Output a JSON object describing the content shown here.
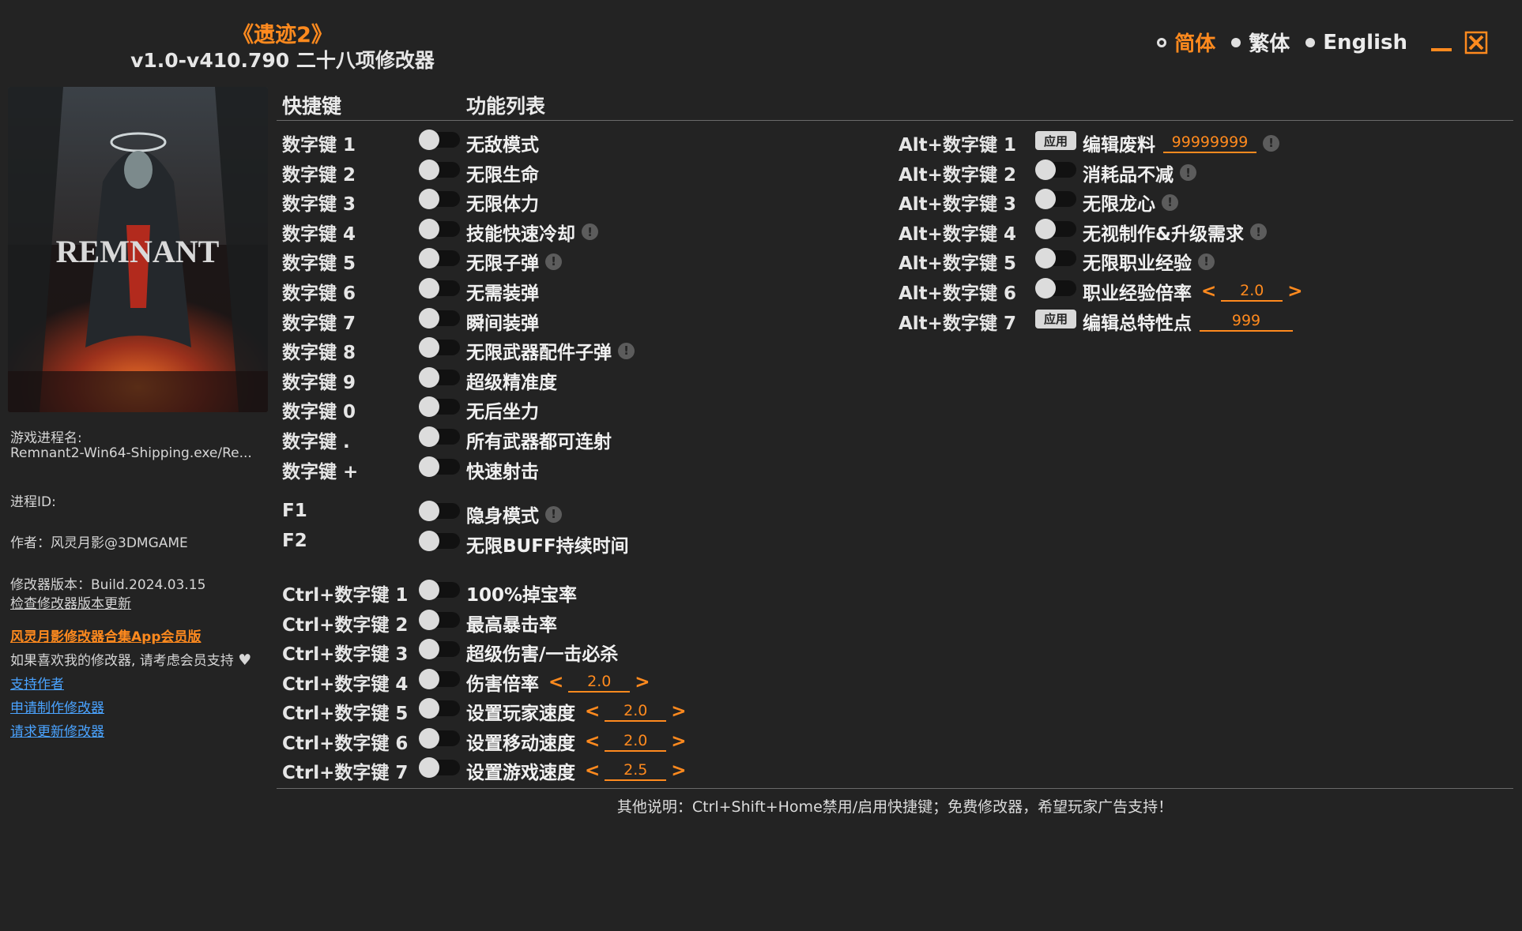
{
  "header": {
    "game_title": "《遗迹2》",
    "trainer_title": "v1.0-v410.790 二十八项修改器"
  },
  "language": {
    "options": [
      {
        "label": "简体",
        "active": true
      },
      {
        "label": "繁体",
        "active": false
      },
      {
        "label": "English",
        "active": false
      }
    ]
  },
  "window": {
    "minimize_icon": "minimize-icon",
    "close_icon": "close-icon",
    "accent": "#ff8a1e"
  },
  "cover": {
    "text": "REMNANT"
  },
  "sidebar": {
    "process_name_label": "游戏进程名:",
    "process_name_value": "Remnant2-Win64-Shipping.exe/Re...",
    "process_id_label": "进程ID:",
    "author": "作者：风灵月影@3DMGAME",
    "version": "修改器版本：Build.2024.03.15",
    "check_update": "检查修改器版本更新",
    "vip_link": "风灵月影修改器合集App会员版",
    "support_text": "如果喜欢我的修改器, 请考虑会员支持",
    "links": [
      "支持作者",
      "申请制作修改器",
      "请求更新修改器"
    ]
  },
  "columns": {
    "hotkey_header": "快捷键",
    "function_header": "功能列表"
  },
  "left_group_1": [
    {
      "key": "数字键 1",
      "label": "无敌模式",
      "info": false
    },
    {
      "key": "数字键 2",
      "label": "无限生命",
      "info": false
    },
    {
      "key": "数字键 3",
      "label": "无限体力",
      "info": false
    },
    {
      "key": "数字键 4",
      "label": "技能快速冷却",
      "info": true
    },
    {
      "key": "数字键 5",
      "label": "无限子弹",
      "info": true
    },
    {
      "key": "数字键 6",
      "label": "无需装弹",
      "info": false
    },
    {
      "key": "数字键 7",
      "label": "瞬间装弹",
      "info": false
    },
    {
      "key": "数字键 8",
      "label": "无限武器配件子弹",
      "info": true
    },
    {
      "key": "数字键 9",
      "label": "超级精准度",
      "info": false
    },
    {
      "key": "数字键 0",
      "label": "无后坐力",
      "info": false
    },
    {
      "key": "数字键 .",
      "label": "所有武器都可连射",
      "info": false
    },
    {
      "key": "数字键 +",
      "label": "快速射击",
      "info": false
    }
  ],
  "left_group_2": [
    {
      "key": "F1",
      "label": "隐身模式",
      "info": true
    },
    {
      "key": "F2",
      "label": "无限BUFF持续时间",
      "info": false
    }
  ],
  "left_group_3": [
    {
      "key": "Ctrl+数字键 1",
      "label": "100%掉宝率",
      "info": false
    },
    {
      "key": "Ctrl+数字键 2",
      "label": "最高暴击率",
      "info": false
    },
    {
      "key": "Ctrl+数字键 3",
      "label": "超级伤害/一击必杀",
      "info": false
    },
    {
      "key": "Ctrl+数字键 4",
      "label": "伤害倍率",
      "value": "2.0"
    },
    {
      "key": "Ctrl+数字键 5",
      "label": "设置玩家速度",
      "value": "2.0"
    },
    {
      "key": "Ctrl+数字键 6",
      "label": "设置移动速度",
      "value": "2.0"
    },
    {
      "key": "Ctrl+数字键 7",
      "label": "设置游戏速度",
      "value": "2.5"
    }
  ],
  "right_group": [
    {
      "key": "Alt+数字键 1",
      "label": "编辑废料",
      "apply": "应用",
      "value": "99999999",
      "info": true
    },
    {
      "key": "Alt+数字键 2",
      "label": "消耗品不减",
      "info": true
    },
    {
      "key": "Alt+数字键 3",
      "label": "无限龙心",
      "info": true
    },
    {
      "key": "Alt+数字键 4",
      "label": "无视制作&升级需求",
      "info": true
    },
    {
      "key": "Alt+数字键 5",
      "label": "无限职业经验",
      "info": true
    },
    {
      "key": "Alt+数字键 6",
      "label": "职业经验倍率",
      "value": "2.0",
      "stepper": true
    },
    {
      "key": "Alt+数字键 7",
      "label": "编辑总特性点",
      "apply": "应用",
      "value": "999"
    }
  ],
  "arrows": {
    "left": "<",
    "right": ">"
  },
  "info_glyph": "!",
  "footer": {
    "note": "其他说明：Ctrl+Shift+Home禁用/启用快捷键；免费修改器，希望玩家广告支持！"
  }
}
